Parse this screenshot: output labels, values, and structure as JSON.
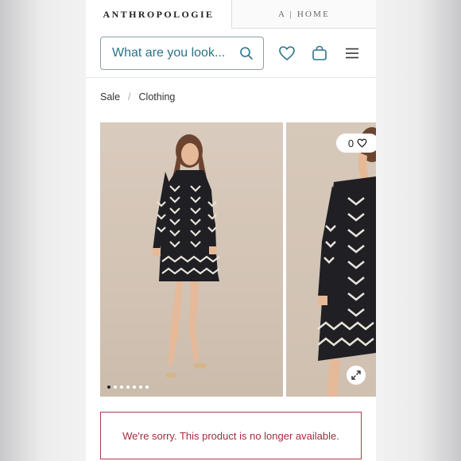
{
  "tabs": {
    "main": "ANTHROPOLOGIE",
    "home": "A | HOME"
  },
  "search": {
    "placeholder": "What are you look..."
  },
  "breadcrumb": {
    "items": [
      "Sale",
      "Clothing"
    ],
    "separator": "/"
  },
  "gallery": {
    "wishlist_count": "0",
    "slide_count": 7,
    "active_slide": 1
  },
  "notice": {
    "message": "We're sorry. This product is no longer available."
  },
  "icons": [
    "search-icon",
    "heart-icon",
    "bag-icon",
    "menu-icon",
    "expand-icon"
  ],
  "colors": {
    "accent_teal": "#2a7388",
    "error_red": "#b23a4c"
  }
}
